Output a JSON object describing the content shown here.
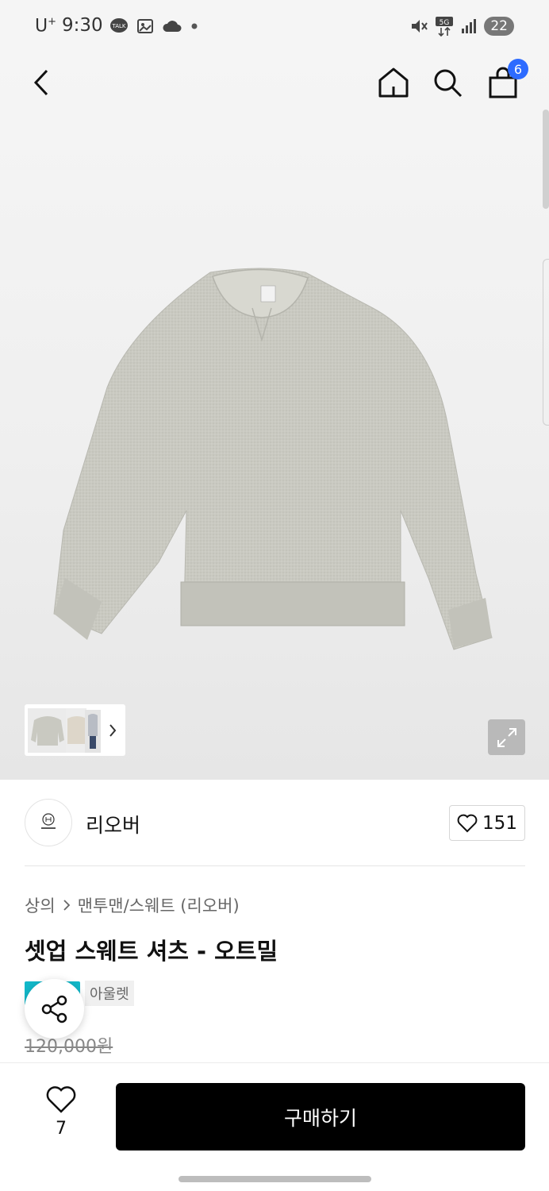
{
  "status_bar": {
    "carrier": "U",
    "carrier_sup": "+",
    "time": "9:30",
    "battery": "22",
    "network": "5G"
  },
  "nav": {
    "cart_count": "6"
  },
  "brand": {
    "name": "리오버",
    "likes": "151"
  },
  "product": {
    "breadcrumb_category": "상의",
    "breadcrumb_sub": "맨투맨/스웨트 (리오버)",
    "title": "셋업 스웨트 셔츠 - 오트밀",
    "badge_outlet": "아울렛",
    "original_price": "120,000원"
  },
  "bottom": {
    "wish_count": "7",
    "buy_label": "구매하기"
  },
  "colors": {
    "sweatshirt": "#c8c8c0",
    "accent_badge": "#12b8c9",
    "cart_badge": "#2d6bff"
  }
}
